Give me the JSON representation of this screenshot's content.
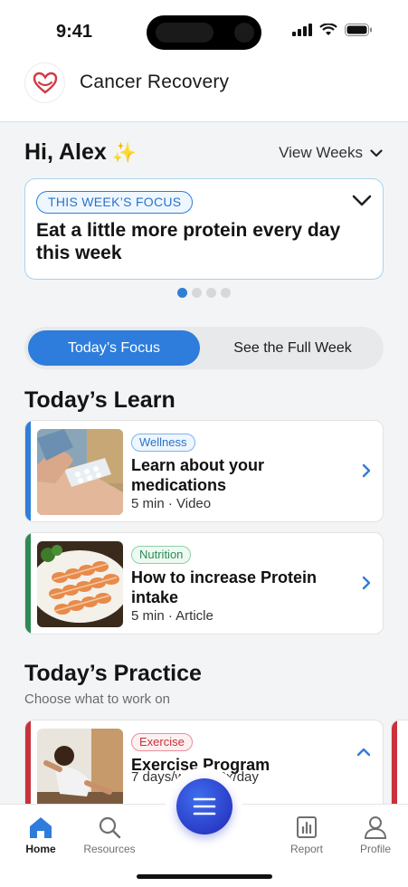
{
  "status_bar": {
    "time": "9:41"
  },
  "header": {
    "app_title": "Cancer Recovery",
    "logo_icon": "heart-hands-icon"
  },
  "greeting": {
    "text": "Hi, Alex",
    "emoji": "✨"
  },
  "view_weeks": {
    "label": "View Weeks"
  },
  "weekly_focus": {
    "pill": "THIS WEEK’S FOCUS",
    "text": "Eat a little more protein every day this week",
    "carousel_total": 4,
    "carousel_active": 1
  },
  "segmented": {
    "active": "Today’s Focus",
    "inactive": "See the Full Week"
  },
  "learn": {
    "title": "Today’s Learn",
    "cards": [
      {
        "tag": "Wellness",
        "title": "Learn about your medications",
        "meta": "5 min · Video",
        "accent": "#2f7fd6"
      },
      {
        "tag": "Nutrition",
        "title": "How to increase Protein intake",
        "meta": "5 min · Article",
        "accent": "#2e8a54"
      }
    ]
  },
  "practice": {
    "title": "Today’s Practice",
    "subtitle": "Choose what to work on",
    "cards": [
      {
        "tag": "Exercise",
        "title": "Exercise Program",
        "meta": "7 days/week · 2x/day",
        "accent": "#c9313b"
      }
    ]
  },
  "bottom_nav": {
    "home": "Home",
    "resources": "Resources",
    "report": "Report",
    "profile": "Profile"
  },
  "colors": {
    "primary": "#2e7cdc",
    "wellness": "#2f7fd6",
    "nutrition": "#2e8a54",
    "exercise": "#c9313b"
  }
}
